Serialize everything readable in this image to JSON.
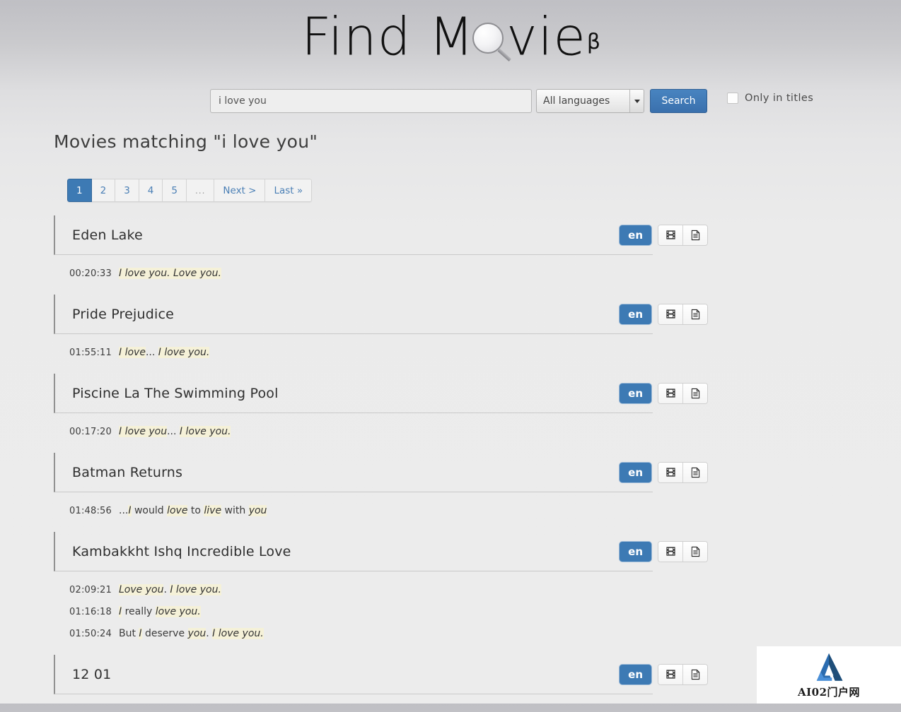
{
  "brand": {
    "text_before": "Find M",
    "text_after": "vie",
    "beta": "β",
    "magnifier_icon": "magnifier-icon"
  },
  "search": {
    "query_value": "i love you",
    "query_placeholder": "",
    "language_selected": "All languages",
    "dropdown_icon": "chevron-down-icon",
    "search_button": "Search",
    "only_in_titles_label": "Only in titles",
    "only_in_titles_checked": false,
    "accent_color": "#3d7ab4"
  },
  "heading": "Movies matching \"i love you\"",
  "pagination": {
    "items": [
      {
        "label": "1",
        "active": true
      },
      {
        "label": "2",
        "active": false
      },
      {
        "label": "3",
        "active": false
      },
      {
        "label": "4",
        "active": false
      },
      {
        "label": "5",
        "active": false
      },
      {
        "label": "...",
        "active": false,
        "ellipsis": true
      },
      {
        "label": "Next >",
        "active": false
      },
      {
        "label": "Last »",
        "active": false
      }
    ]
  },
  "results": [
    {
      "title": "Eden Lake",
      "lang": "en",
      "video_icon": "film-strip-icon",
      "subtitle_icon": "document-icon",
      "subs": [
        {
          "time": "00:20:33",
          "parts": [
            {
              "t": "I love you. Love you.",
              "hl": true
            }
          ]
        }
      ]
    },
    {
      "title": "Pride Prejudice",
      "lang": "en",
      "video_icon": "film-strip-icon",
      "subtitle_icon": "document-icon",
      "subs": [
        {
          "time": "01:55:11",
          "parts": [
            {
              "t": "I love",
              "hl": true
            },
            {
              "t": "... ",
              "hl": false
            },
            {
              "t": "I love you.",
              "hl": true
            }
          ]
        }
      ]
    },
    {
      "title": "Piscine La The Swimming Pool",
      "lang": "en",
      "video_icon": "film-strip-icon",
      "subtitle_icon": "document-icon",
      "subs": [
        {
          "time": "00:17:20",
          "parts": [
            {
              "t": "I love you",
              "hl": true
            },
            {
              "t": "... ",
              "hl": false
            },
            {
              "t": "I love you.",
              "hl": true
            }
          ]
        }
      ]
    },
    {
      "title": "Batman Returns",
      "lang": "en",
      "video_icon": "film-strip-icon",
      "subtitle_icon": "document-icon",
      "subs": [
        {
          "time": "01:48:56",
          "parts": [
            {
              "t": "...",
              "hl": false
            },
            {
              "t": "I",
              "hl": true
            },
            {
              "t": " would ",
              "hl": false
            },
            {
              "t": "love",
              "hl": true
            },
            {
              "t": " to ",
              "hl": false
            },
            {
              "t": "live",
              "hl": true
            },
            {
              "t": " with ",
              "hl": false
            },
            {
              "t": "you",
              "hl": true
            }
          ]
        }
      ]
    },
    {
      "title": "Kambakkht Ishq Incredible Love",
      "lang": "en",
      "video_icon": "film-strip-icon",
      "subtitle_icon": "document-icon",
      "subs": [
        {
          "time": "02:09:21",
          "parts": [
            {
              "t": "Love you",
              "hl": true
            },
            {
              "t": ". ",
              "hl": false
            },
            {
              "t": "I love you.",
              "hl": true
            }
          ]
        },
        {
          "time": "01:16:18",
          "parts": [
            {
              "t": "I",
              "hl": true
            },
            {
              "t": " really ",
              "hl": false
            },
            {
              "t": "love you.",
              "hl": true
            }
          ]
        },
        {
          "time": "01:50:24",
          "parts": [
            {
              "t": "But ",
              "hl": false
            },
            {
              "t": "I",
              "hl": true
            },
            {
              "t": " deserve ",
              "hl": false
            },
            {
              "t": "you",
              "hl": true
            },
            {
              "t": ". ",
              "hl": false
            },
            {
              "t": "I love you.",
              "hl": true
            }
          ]
        }
      ]
    },
    {
      "title": "12 01",
      "lang": "en",
      "video_icon": "film-strip-icon",
      "subtitle_icon": "document-icon",
      "subs": []
    }
  ],
  "watermark": {
    "text": "AI02门户网",
    "logo_icon": "ai02-logo-icon"
  }
}
